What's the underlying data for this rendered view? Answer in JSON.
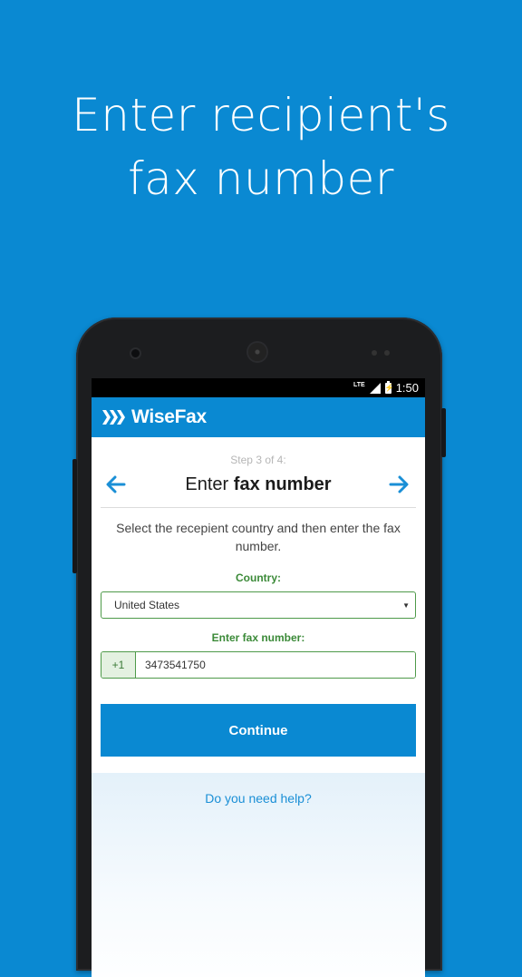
{
  "promo": {
    "line1": "Enter recipient's",
    "line2": "fax number"
  },
  "statusbar": {
    "network": "LTE",
    "time": "1:50"
  },
  "appbar": {
    "title": "WiseFax"
  },
  "step": {
    "progress": "Step 3 of 4:",
    "title_normal": "Enter",
    "title_bold": "fax number"
  },
  "form": {
    "instructions": "Select the recepient country and then enter the fax number.",
    "country_label": "Country:",
    "country_value": "United States",
    "fax_label": "Enter fax number:",
    "prefix": "+1",
    "fax_value": "3473541750",
    "continue_label": "Continue"
  },
  "help": {
    "link": "Do you need help?"
  },
  "colors": {
    "brand": "#0a89d2",
    "label_green": "#3b8a38",
    "link": "#1a8fd6"
  }
}
